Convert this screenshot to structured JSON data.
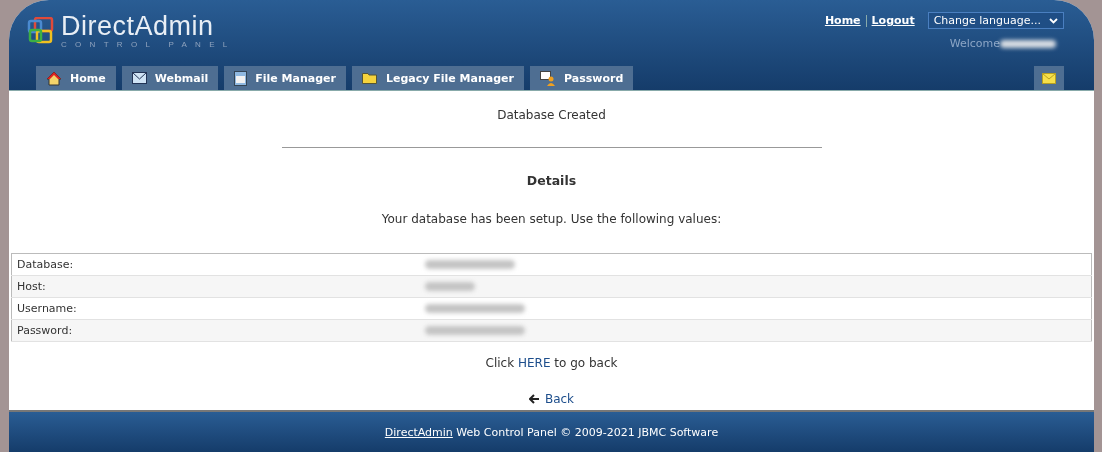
{
  "logo": {
    "name": "DirectAdmin",
    "subtitle": "CONTROL PANEL"
  },
  "top_links": [
    "Home",
    "Logout"
  ],
  "language_select": {
    "value": "Change language..."
  },
  "welcome": "Welcome",
  "tabs": [
    "Home",
    "Webmail",
    "File Manager",
    "Legacy File Manager",
    "Password"
  ],
  "title": "Database Created",
  "details_heading": "Details",
  "message": "Your database has been setup. Use the following values:",
  "values_table": {
    "rows": [
      {
        "label": "Database:"
      },
      {
        "label": "Host:"
      },
      {
        "label": "Username:"
      },
      {
        "label": "Password:"
      }
    ]
  },
  "back_prompt": {
    "before": "Click ",
    "link": "HERE",
    "after": " to go back"
  },
  "back_link": "Back",
  "footer": {
    "link": "DirectAdmin",
    "text": " Web Control Panel © 2009-2021 JBMC Software"
  }
}
